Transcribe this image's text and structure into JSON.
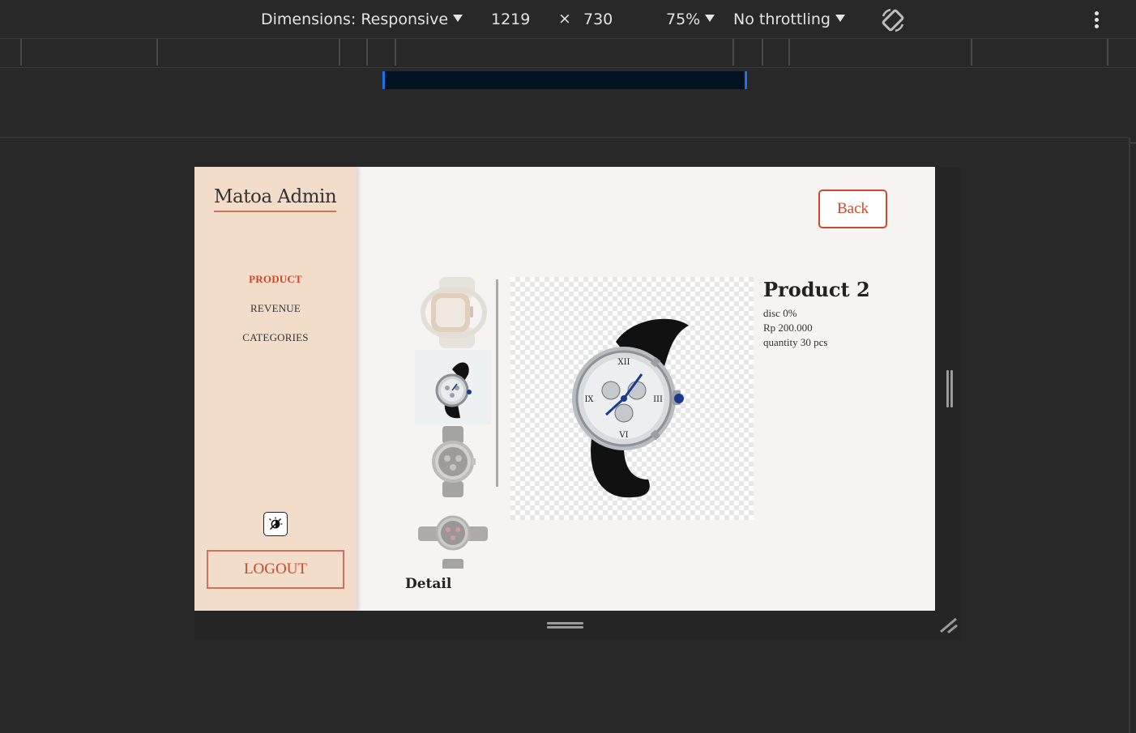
{
  "devtools": {
    "dimensions_label": "Dimensions: Responsive",
    "width": "1219",
    "height": "730",
    "times_symbol": "×",
    "zoom": "75%",
    "throttling": "No throttling",
    "rotate_icon": "rotate-icon",
    "more_icon": "kebab-menu-icon"
  },
  "app": {
    "brand": "Matoa Admin",
    "nav": [
      {
        "label": "PRODUCT",
        "active": true
      },
      {
        "label": "REVENUE",
        "active": false
      },
      {
        "label": "CATEGORIES",
        "active": false
      }
    ],
    "theme_toggle_icon": "theme-toggle-icon",
    "logout_label": "LOGOUT",
    "back_label": "Back",
    "accent_color": "#d0482a",
    "sidebar_color": "#f2dcca"
  },
  "product": {
    "title": "Product 2",
    "discount": "disc 0%",
    "price": "Rp 200.000",
    "quantity": "quantity 30 pcs",
    "detail_heading": "Detail",
    "thumbnails": [
      "smartwatch-gold",
      "chronograph-black-strap",
      "chronograph-steel",
      "chronograph-red",
      "watch-partial"
    ]
  }
}
